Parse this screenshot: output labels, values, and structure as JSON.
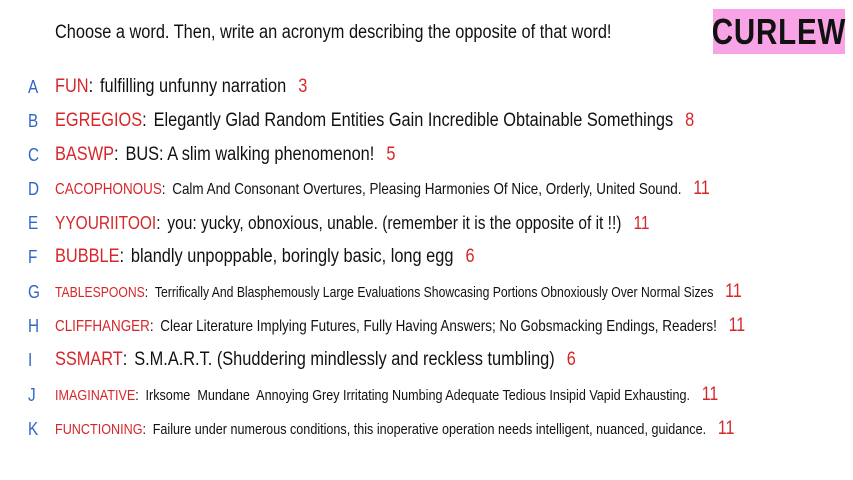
{
  "prompt": "Choose a word. Then, write an acronym describing the opposite of that word!",
  "brand": "CURLEW",
  "entries": [
    {
      "letter": "A",
      "word": "FUN",
      "definition": "fulfilling unfunny narration",
      "score": "3"
    },
    {
      "letter": "B",
      "word": "EGREGIOS",
      "definition": "Elegantly Glad Random Entities Gain Incredible Obtainable Somethings",
      "score": "8"
    },
    {
      "letter": "C",
      "word": "BASWP",
      "definition": "BUS: A slim walking phenomenon!",
      "score": "5"
    },
    {
      "letter": "D",
      "word": "CACOPHONOUS",
      "definition": "Calm And Consonant Overtures, Pleasing Harmonies Of Nice, Orderly, United Sound.",
      "score": "11"
    },
    {
      "letter": "E",
      "word": "YYOURIITOOI",
      "definition": "you: yucky, obnoxious, unable. (remember it is the opposite of it !!)",
      "score": "11"
    },
    {
      "letter": "F",
      "word": "BUBBLE",
      "definition": "blandly unpoppable, boringly basic, long egg",
      "score": "6"
    },
    {
      "letter": "G",
      "word": "TABLESPOONS",
      "definition": "Terrifically And Blasphemously Large Evaluations Showcasing Portions Obnoxiously Over Normal Sizes",
      "score": "11"
    },
    {
      "letter": "H",
      "word": "CLIFFHANGER",
      "definition": "Clear Literature Implying Futures, Fully Having Answers; No Gobsmacking Endings, Readers!",
      "score": "11"
    },
    {
      "letter": "I",
      "word": "SSMART",
      "definition": "S.M.A.R.T. (Shuddering mindlessly and reckless tumbling)",
      "score": "6"
    },
    {
      "letter": "J",
      "word": "IMAGINATIVE",
      "definition": "Irksome  Mundane  Annoying Grey Irritating Numbing Adequate Tedious Insipid Vapid Exhausting.",
      "score": "11"
    },
    {
      "letter": "K",
      "word": "FUNCTIONING",
      "definition": "Failure under numerous conditions, this inoperative operation needs intelligent, nuanced, guidance.",
      "score": "11"
    }
  ]
}
